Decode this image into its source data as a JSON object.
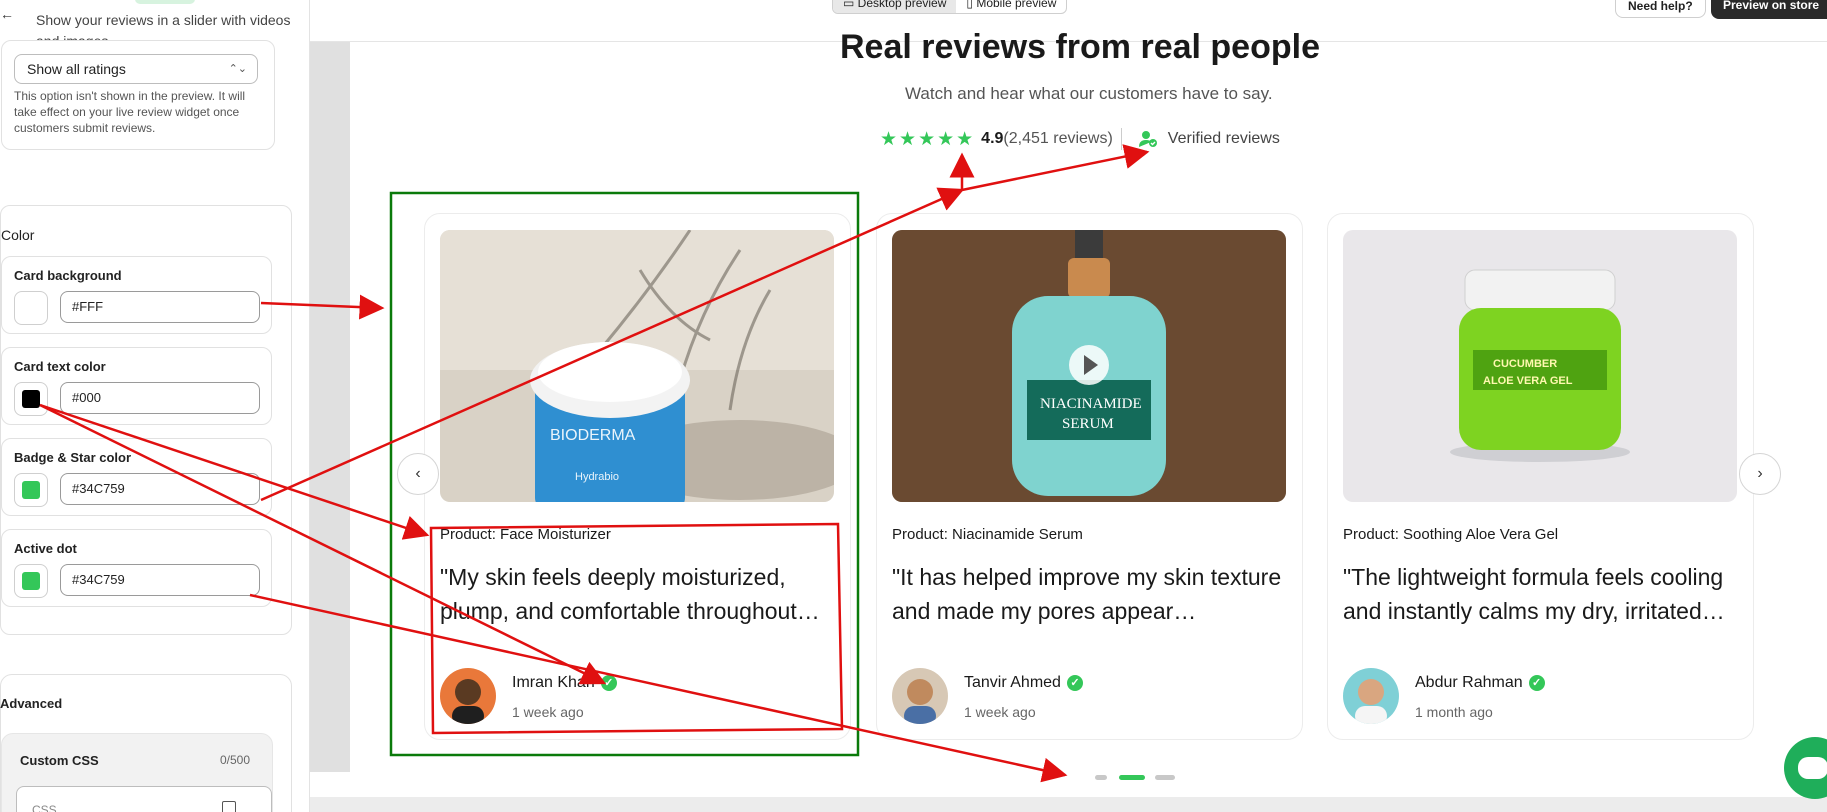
{
  "panel": {
    "description": "Show your reviews in a slider with videos and images",
    "rating_filter": {
      "selected": "Show all ratings",
      "hint": "This option isn't shown in the preview. It will take effect on your live review widget once customers submit reviews."
    },
    "color_section": {
      "title": "Color",
      "fields": [
        {
          "label": "Card background",
          "value": "#FFF",
          "swatch": "#FFFFFF"
        },
        {
          "label": "Card text color",
          "value": "#000",
          "swatch": "#000000"
        },
        {
          "label": "Badge & Star color",
          "value": "#34C759",
          "swatch": "#34C759"
        },
        {
          "label": "Active dot",
          "value": "#34C759",
          "swatch": "#34C759"
        }
      ]
    },
    "advanced": {
      "title": "Advanced",
      "custom_css_label": "Custom CSS",
      "custom_css_count": "0/500",
      "custom_css_placeholder": "CSS"
    }
  },
  "topbar": {
    "desktop_preview": "Desktop preview",
    "mobile_preview": "Mobile preview",
    "need_help": "Need help?",
    "preview_on_store": "Preview on store"
  },
  "widget": {
    "title": "Real reviews from real people",
    "subtitle": "Watch and hear what our customers have to say.",
    "stars": "★★★★★",
    "rating": "4.9",
    "review_count": "(2,451 reviews)",
    "verified_label": "Verified reviews",
    "reviews": [
      {
        "product": "Product: Face Moisturizer",
        "quote": "\"My skin feels deeply moisturized, plump, and comfortable throughout…",
        "name": "Imran Khan",
        "time": "1 week ago"
      },
      {
        "product": "Product: Niacinamide Serum",
        "quote": "\"It has helped improve my skin texture and made my pores appear…",
        "name": "Tanvir Ahmed",
        "time": "1 week ago"
      },
      {
        "product": "Product: Soothing Aloe Vera Gel",
        "quote": "\"The lightweight formula feels cooling and instantly calms my dry, irritated…",
        "name": "Abdur Rahman",
        "time": "1 month ago"
      }
    ],
    "prev_icon": "‹",
    "next_icon": "›",
    "active_dot_index": 1
  },
  "colors": {
    "accent": "#34C759",
    "annotation_red": "#E01010",
    "annotation_green": "#0A7A0A"
  },
  "icons": [
    "back-arrow-icon",
    "chevron-updown-icon",
    "star-icon",
    "verified-user-icon",
    "verified-check-icon",
    "chevron-left-icon",
    "chevron-right-icon",
    "play-icon",
    "copy-icon",
    "chat-icon"
  ]
}
